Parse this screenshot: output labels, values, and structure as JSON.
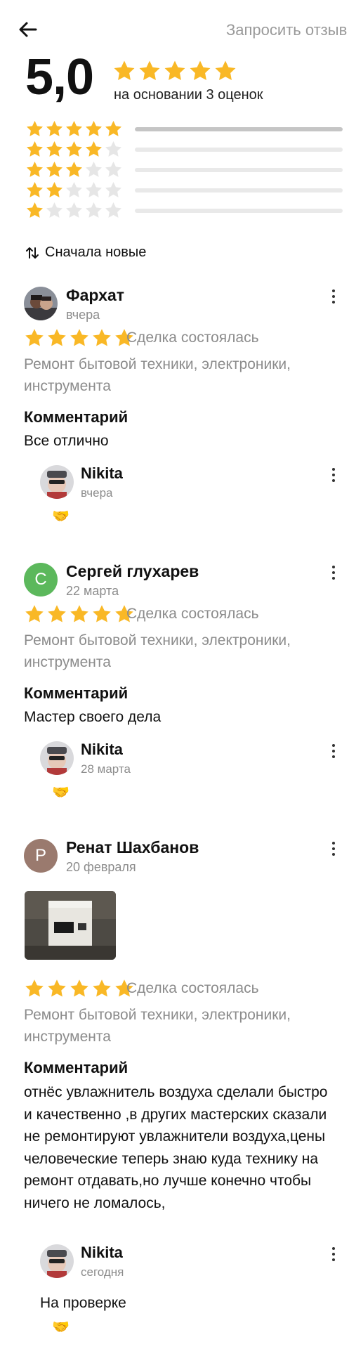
{
  "header": {
    "request_reviews_label": "Запросить отзыв"
  },
  "summary": {
    "rating": "5,0",
    "stars": 5,
    "basis_text": "на основании 3 оценок",
    "distribution": [
      {
        "stars": 5,
        "count": "3",
        "fraction": 1.0
      },
      {
        "stars": 4,
        "count": "0",
        "fraction": 0
      },
      {
        "stars": 3,
        "count": "0",
        "fraction": 0
      },
      {
        "stars": 2,
        "count": "0",
        "fraction": 0
      },
      {
        "stars": 1,
        "count": "0",
        "fraction": 0
      }
    ]
  },
  "sort": {
    "label": "Сначала новые"
  },
  "reviews": [
    {
      "author": "Фархат",
      "date": "вчера",
      "stars": 5,
      "deal": "Сделка состоялась",
      "category": "Ремонт бытовой техники, электроники, инструмента",
      "comment_title": "Комментарий",
      "comment": "Все отлично",
      "reply": {
        "author": "Nikita",
        "date": "вчера",
        "text": "",
        "reaction": "🤝"
      }
    },
    {
      "author": "Сергей глухарев",
      "avatar_letter": "С",
      "avatar_color": "#5cb85c",
      "date": "22 марта",
      "stars": 5,
      "deal": "Сделка состоялась",
      "category": "Ремонт бытовой техники, электроники, инструмента",
      "comment_title": "Комментарий",
      "comment": "Мастер своего дела",
      "reply": {
        "author": "Nikita",
        "date": "28 марта",
        "text": "",
        "reaction": "🤝"
      }
    },
    {
      "author": "Ренат Шахбанов",
      "avatar_letter": "Р",
      "avatar_color": "#9a7a6e",
      "date": "20 февраля",
      "stars": 5,
      "deal": "Сделка состоялась",
      "category": "Ремонт бытовой техники, электроники, инструмента",
      "comment_title": "Комментарий",
      "comment": "отнёс увлажнитель воздуха сделали быстро и качественно ,в других мастерских сказали не ремонтируют увлажнители воздуха,цены человеческие теперь знаю куда технику на ремонт отдавать,но лучше конечно чтобы ничего не ломалось,",
      "reply": {
        "author": "Nikita",
        "date": "сегодня",
        "text": "На проверке",
        "reaction": "🤝"
      }
    }
  ],
  "colors": {
    "star": "#f9b826",
    "star_empty": "#e6e6e6"
  },
  "icons": {
    "back": "arrow-left-icon",
    "sort": "sort-arrows-icon",
    "more": "more-vertical-icon",
    "reaction": "handshake-icon"
  }
}
